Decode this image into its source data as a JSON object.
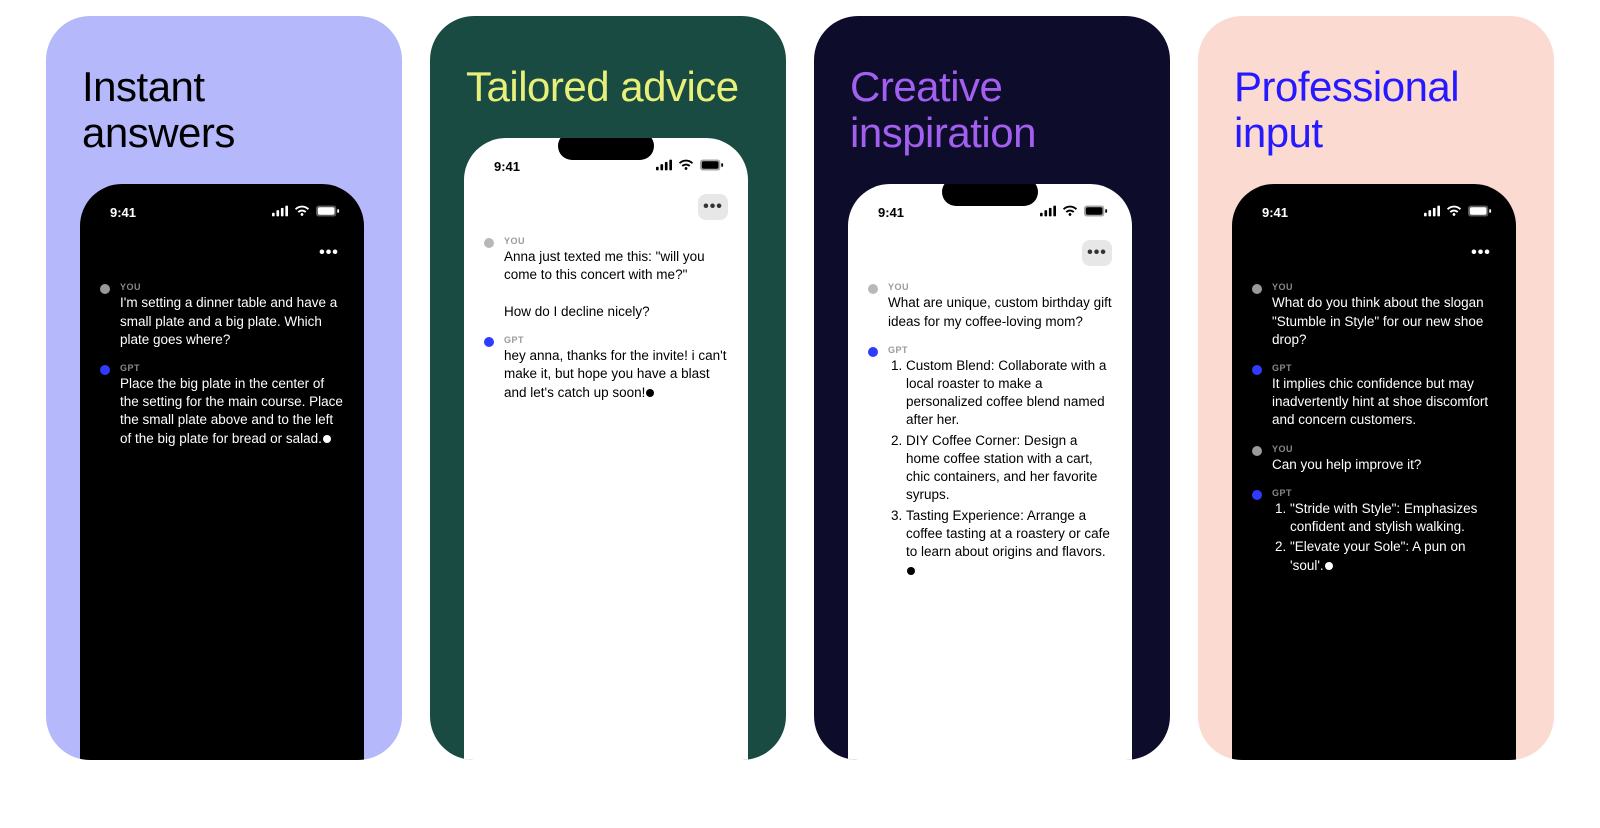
{
  "phone_time": "9:41",
  "role_labels": {
    "user": "YOU",
    "assistant": "GPT"
  },
  "colors": {
    "user_dot_dark": "#9a9a9a",
    "user_dot_light": "#b8b8b8",
    "gpt_dot": "#2f3cff"
  },
  "cards": [
    {
      "title": "Instant answers",
      "bg": "#b5b8fb",
      "title_color": "#000000",
      "phone_theme": "dark",
      "messages": [
        {
          "role": "user",
          "text": "I'm setting a dinner table and have a small plate and a big plate. Which plate goes where?"
        },
        {
          "role": "assistant",
          "text": "Place the big plate in the center of the setting for the main course. Place the small plate above and to the left of the big plate for bread or salad."
        }
      ]
    },
    {
      "title": "Tailored advice",
      "bg": "#1a4b42",
      "title_color": "#e9f07a",
      "phone_theme": "light",
      "messages": [
        {
          "role": "user",
          "text": "Anna just texted me this: \"will you come to this concert with me?\"\n\nHow do I decline nicely?"
        },
        {
          "role": "assistant",
          "text": "hey anna, thanks for the invite! i can't make it, but hope you have a blast and let's catch up soon!"
        }
      ]
    },
    {
      "title": "Creative inspiration",
      "bg": "#0e0c2b",
      "title_color": "#a25ff0",
      "phone_theme": "light",
      "messages": [
        {
          "role": "user",
          "text": "What are unique, custom birthday gift ideas for my coffee-loving mom?"
        },
        {
          "role": "assistant",
          "list": [
            "Custom Blend: Collaborate with a local roaster to make a personalized coffee blend named after her.",
            "DIY Coffee Corner: Design a home coffee station with a cart, chic containers, and her favorite syrups.",
            "Tasting Experience: Arrange a coffee tasting at a roastery or cafe to learn about origins and flavors."
          ]
        }
      ]
    },
    {
      "title": "Professional input",
      "bg": "#fadad1",
      "title_color": "#2719ff",
      "phone_theme": "dark",
      "messages": [
        {
          "role": "user",
          "text": "What do you think about the slogan \"Stumble in Style\" for our new shoe drop?"
        },
        {
          "role": "assistant",
          "text": "It implies chic confidence but may inadvertently hint at shoe discomfort and concern customers."
        },
        {
          "role": "user",
          "text": "Can you help improve it?"
        },
        {
          "role": "assistant",
          "list": [
            "\"Stride with Style\": Emphasizes confident and stylish walking.",
            "\"Elevate your Sole\": A pun on 'soul'."
          ]
        }
      ]
    }
  ]
}
